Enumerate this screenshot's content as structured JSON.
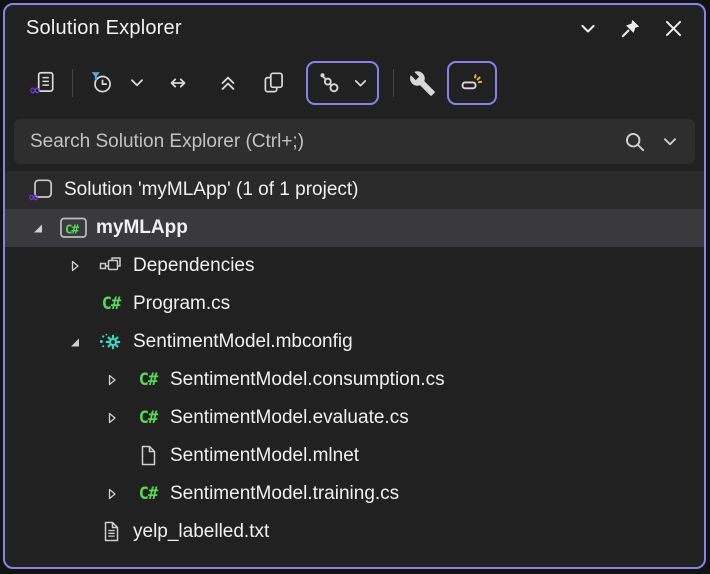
{
  "titlebar": {
    "title": "Solution Explorer",
    "icons": [
      "chevron-down-icon",
      "pin-icon",
      "close-icon"
    ]
  },
  "toolbar": {
    "buttons": [
      "switch-views",
      "pending-changes-filter",
      "filter-dropdown",
      "sync-with-active-document",
      "collapse-all",
      "show-all-files",
      "file-nesting",
      "properties",
      "preview-selected-items"
    ]
  },
  "search": {
    "placeholder": "Search Solution Explorer (Ctrl+;)"
  },
  "tree": {
    "items": [
      {
        "label": "Solution 'myMLApp' (1 of 1 project)",
        "icon": "solution",
        "depth": 0,
        "expander": "none",
        "selected": false
      },
      {
        "label": "myMLApp",
        "icon": "csharp-project",
        "depth": 1,
        "expander": "expanded",
        "selected": true
      },
      {
        "label": "Dependencies",
        "icon": "dependencies",
        "depth": 2,
        "expander": "collapsed",
        "selected": false
      },
      {
        "label": "Program.cs",
        "icon": "csharp-file",
        "depth": 2,
        "expander": "none",
        "selected": false
      },
      {
        "label": "SentimentModel.mbconfig",
        "icon": "mlnet-model-builder",
        "depth": 2,
        "expander": "expanded",
        "selected": false
      },
      {
        "label": "SentimentModel.consumption.cs",
        "icon": "csharp-file",
        "depth": 3,
        "expander": "collapsed",
        "selected": false
      },
      {
        "label": "SentimentModel.evaluate.cs",
        "icon": "csharp-file",
        "depth": 3,
        "expander": "collapsed",
        "selected": false
      },
      {
        "label": "SentimentModel.mlnet",
        "icon": "file",
        "depth": 3,
        "expander": "none",
        "selected": false
      },
      {
        "label": "SentimentModel.training.cs",
        "icon": "csharp-file",
        "depth": 3,
        "expander": "collapsed",
        "selected": false
      },
      {
        "label": "yelp_labelled.txt",
        "icon": "text-file",
        "depth": 2,
        "expander": "none",
        "selected": false
      }
    ]
  },
  "colors": {
    "accent_border": "#8a82ea",
    "csharp_green": "#57d857",
    "mlnet_teal": "#3fd8c2",
    "vs_logo_purple": "#7b35e0",
    "filter_blue": "#58aaf2",
    "sparkle_orange": "#edb04d",
    "selected_row_bg": "#3a3a3c",
    "panel_bg": "#212121",
    "search_bg": "#2e2e2f"
  }
}
